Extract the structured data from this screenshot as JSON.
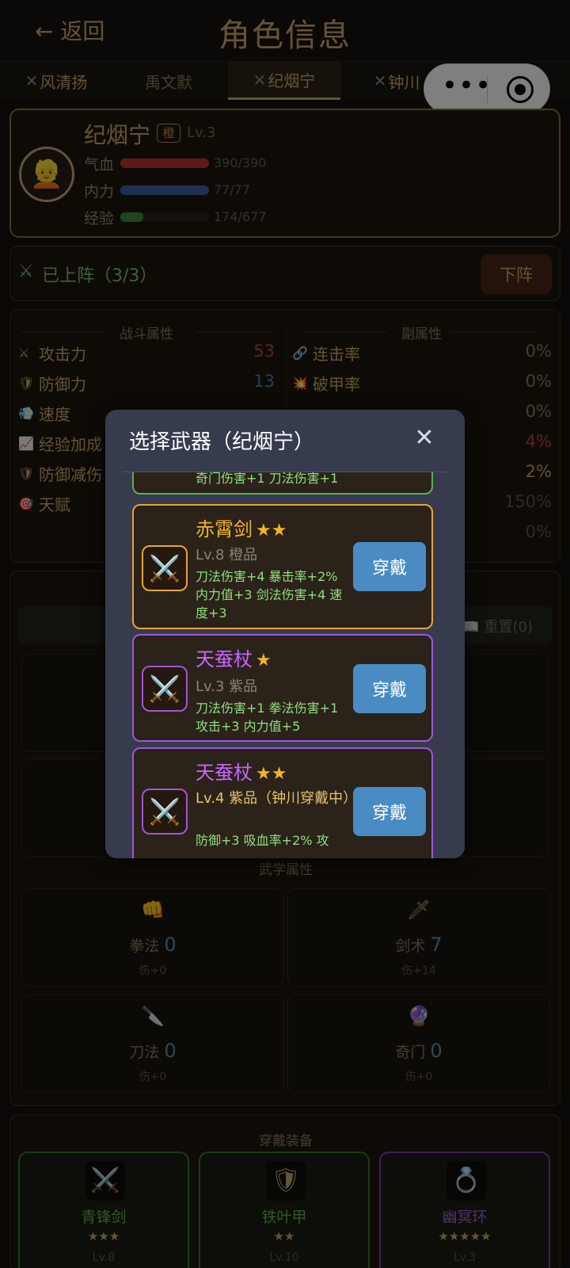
{
  "header": {
    "back_label": "← 返回",
    "title": "角色信息"
  },
  "tabs": [
    {
      "label": "风清扬",
      "deployed": true
    },
    {
      "label": "禹文默",
      "deployed": false
    },
    {
      "label": "纪烟宁",
      "deployed": true,
      "active": true
    },
    {
      "label": "钟川",
      "deployed": true
    }
  ],
  "capsule": {
    "more": "•••"
  },
  "character": {
    "name": "纪烟宁",
    "rank": "橙",
    "level": "Lv.3",
    "avatar": "👱",
    "hp_label": "气血",
    "hp_value": "390/390",
    "hp_ratio": 1.0,
    "mp_label": "内力",
    "mp_value": "77/77",
    "mp_ratio": 1.0,
    "exp_label": "经验",
    "exp_value": "174/677",
    "exp_ratio": 0.257
  },
  "deploy": {
    "status": "已上阵（3/3）",
    "button": "下阵"
  },
  "attributes": {
    "left_title": "战斗属性",
    "right_title": "副属性",
    "left": [
      {
        "icon": "⚔",
        "label": "攻击力",
        "value": "53",
        "color": "#b8453e"
      },
      {
        "icon": "🛡",
        "label": "防御力",
        "value": "13",
        "color": "#4f7fa8"
      },
      {
        "icon": "💨",
        "label": "速度",
        "value": "",
        "color": "#c9a76a"
      },
      {
        "icon": "📈",
        "label": "经验加成",
        "value": "",
        "color": "#c9a76a"
      },
      {
        "icon": "🛡",
        "label": "防御减伤",
        "value": "",
        "color": "#c9a76a"
      },
      {
        "icon": "🎯",
        "label": "天赋",
        "value": "",
        "color": "#c9a76a"
      }
    ],
    "right": [
      {
        "icon": "🔗",
        "label": "连击率",
        "value": "0%",
        "color": "#8a7a5a"
      },
      {
        "icon": "💥",
        "label": "破甲率",
        "value": "0%",
        "color": "#8a7a5a"
      },
      {
        "icon": "",
        "label": "",
        "value": "0%",
        "color": "#8a7a5a"
      },
      {
        "icon": "",
        "label": "",
        "value": "4%",
        "color": "#b8453e"
      },
      {
        "icon": "",
        "label": "",
        "value": "2%",
        "color": "#c9a76a"
      },
      {
        "icon": "",
        "label": "",
        "value": "150%",
        "color": "#5e5444"
      },
      {
        "icon": "",
        "label": "",
        "value": "0%",
        "color": "#5e5444"
      }
    ]
  },
  "martial": {
    "reset_label": "📖 重置(0)",
    "section_title": "武学属性",
    "skills": [
      {
        "icon": "👊",
        "name": "拳法",
        "value": "0",
        "damage": "伤+0"
      },
      {
        "icon": "🗡",
        "name": "剑术",
        "value": "7",
        "damage": "伤+14"
      },
      {
        "icon": "🔪",
        "name": "刀法",
        "value": "0",
        "damage": "伤+0"
      },
      {
        "icon": "🔮",
        "name": "奇门",
        "value": "0",
        "damage": "伤+0"
      }
    ]
  },
  "equipment": {
    "title": "穿戴装备",
    "items": [
      {
        "icon": "⚔️",
        "name": "青锋剑",
        "stars": "★★★",
        "level": "Lv.8",
        "color": "#5fb04f",
        "border": "#2f7a2f"
      },
      {
        "icon": "🛡",
        "name": "铁叶甲",
        "stars": "★★",
        "level": "Lv.10",
        "color": "#5fb04f",
        "border": "#2f7a2f"
      },
      {
        "icon": "💍",
        "name": "幽冥环",
        "stars": "★★★★★",
        "level": "Lv.3",
        "color": "#a463d8",
        "border": "#7a3fb0"
      }
    ]
  },
  "modal": {
    "title": "选择武器（纪烟宁）",
    "close": "✕",
    "partial_effect": "奇门伤害+1 刀法伤害+1",
    "weapons": [
      {
        "icon": "⚔️",
        "name": "赤霄剑",
        "stars": "★★",
        "level": "Lv.8 橙品",
        "effects": "刀法伤害+4 暴击率+2% 内力值+3 剑法伤害+4 速度+3",
        "button": "穿戴",
        "name_color": "#f0b429",
        "border": "#e8a535"
      },
      {
        "icon": "⚔️",
        "name": "天蚕杖",
        "stars": "★",
        "level": "Lv.3 紫品",
        "effects": "刀法伤害+1 拳法伤害+1 攻击+3 内力值+5",
        "button": "穿戴",
        "name_color": "#c766ff",
        "border": "#a255d8"
      },
      {
        "icon": "⚔️",
        "name": "天蚕杖",
        "stars": "★★",
        "level": "Lv.4 紫品（钟川穿戴中）",
        "effects": "防御+3 吸血率+2% 攻",
        "button": "穿戴",
        "name_color": "#c766ff",
        "border": "#a255d8"
      }
    ]
  }
}
